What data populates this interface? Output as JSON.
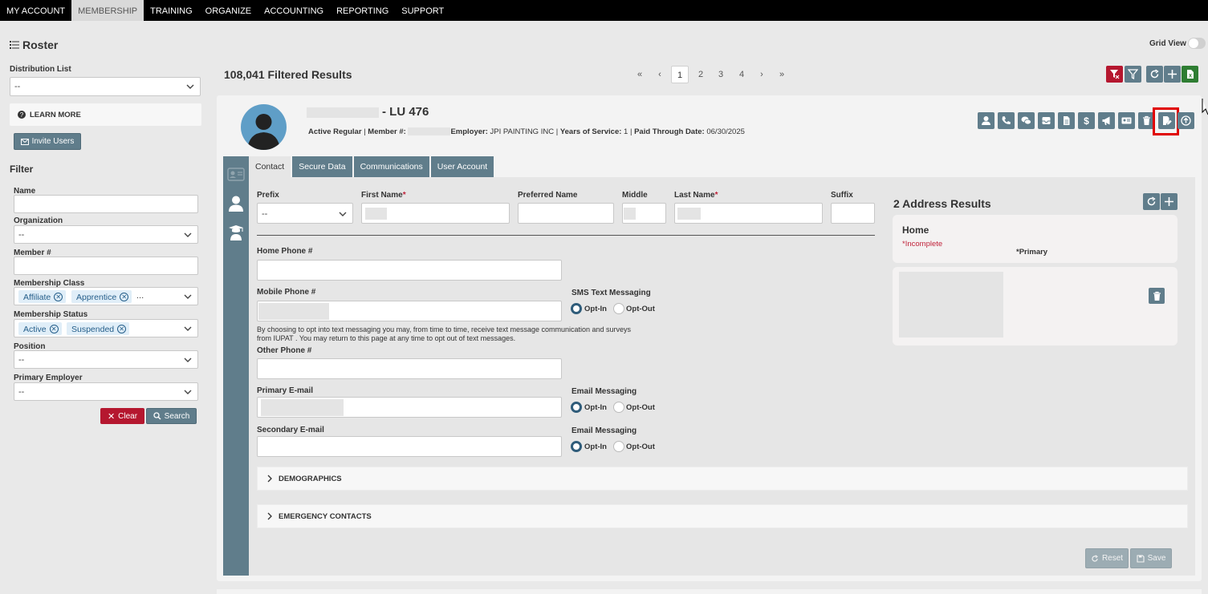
{
  "nav": {
    "items": [
      "MY ACCOUNT",
      "MEMBERSHIP",
      "TRAINING",
      "ORGANIZE",
      "ACCOUNTING",
      "REPORTING",
      "SUPPORT"
    ],
    "active_index": 1
  },
  "left": {
    "title": "Roster",
    "distribution_list_label": "Distribution List",
    "distribution_list_value": "--",
    "learn_more": "LEARN MORE",
    "invite_users": "Invite Users",
    "filter_title": "Filter",
    "name_label": "Name",
    "organization_label": "Organization",
    "organization_value": "--",
    "member_label": "Member #",
    "membership_class_label": "Membership Class",
    "membership_class_chips": [
      "Affiliate",
      "Apprentice"
    ],
    "membership_class_more": "...",
    "membership_status_label": "Membership Status",
    "membership_status_chips": [
      "Active",
      "Suspended"
    ],
    "position_label": "Position",
    "position_value": "--",
    "primary_employer_label": "Primary Employer",
    "primary_employer_value": "--",
    "clear_button": "Clear",
    "search_button": "Search"
  },
  "header": {
    "grid_view_label": "Grid View",
    "results_text": "108,041 Filtered Results",
    "pages": [
      "1",
      "2",
      "3",
      "4"
    ],
    "active_page": "1",
    "first": "«",
    "prev": "‹",
    "next": "›",
    "last": "»"
  },
  "member": {
    "name_suffix": "- LU 476",
    "status": "Active Regular",
    "member_no_label": "Member #:",
    "employer_label": "Employer:",
    "employer": "JPI PAINTING INC",
    "years_label": "Years of Service:",
    "years": "1",
    "paid_label": "Paid Through Date:",
    "paid_through": "06/30/2025",
    "sep": "|"
  },
  "tabs": [
    "Contact",
    "Secure Data",
    "Communications",
    "User Account"
  ],
  "form": {
    "prefix_label": "Prefix",
    "prefix_value": "--",
    "first_name_label": "First Name",
    "preferred_name_label": "Preferred Name",
    "middle_label": "Middle",
    "last_name_label": "Last Name",
    "suffix_label": "Suffix",
    "required_mark": "*",
    "home_phone_label": "Home Phone #",
    "mobile_phone_label": "Mobile Phone #",
    "sms_label": "SMS Text Messaging",
    "opt_in": "Opt-In",
    "opt_out": "Opt-Out",
    "sms_disclaimer_line1": "By choosing to opt into text messaging you may, from time to time, receive text message communication and surveys",
    "sms_disclaimer_line2": "from IUPAT . You may return to this page at any time to opt out of text messages.",
    "other_phone_label": "Other Phone #",
    "primary_email_label": "Primary E-mail",
    "secondary_email_label": "Secondary E-mail",
    "email_messaging_label": "Email Messaging",
    "demographics": "DEMOGRAPHICS",
    "emergency_contacts": "EMERGENCY CONTACTS",
    "reset": "Reset",
    "save": "Save"
  },
  "address": {
    "title": "2 Address Results",
    "type": "Home",
    "incomplete": "*Incomplete",
    "primary": "*Primary"
  },
  "colors": {
    "slate": "#607d8b",
    "red": "#b5172f",
    "green": "#2e7d32",
    "highlight": "#e00000"
  }
}
